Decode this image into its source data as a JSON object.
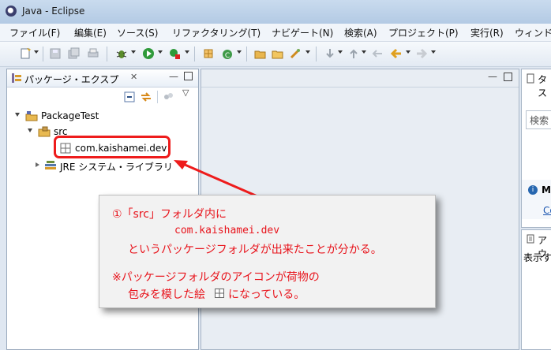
{
  "window": {
    "title": "Java - Eclipse"
  },
  "menu": [
    "ファイル(F)",
    "編集(E)",
    "ソース(S)",
    "リファクタリング(T)",
    "ナビゲート(N)",
    "検索(A)",
    "プロジェクト(P)",
    "実行(R)",
    "ウィンド"
  ],
  "explorer": {
    "tab_label": "パッケージ・エクスプ",
    "tree": {
      "project": "PackageTest",
      "src": "src",
      "package": "com.kaishamei.dev",
      "jre": "JRE システム・ライブラリ"
    }
  },
  "right": {
    "tab1": "タス",
    "search_placeholder": "検索",
    "info_label": "M",
    "link": "Co",
    "tab2": "アウ",
    "text": "表示す"
  },
  "callout": {
    "line1": "①「src」フォルダ内に",
    "line2": "com.kaishamei.dev",
    "line3": "というパッケージフォルダが出来たことが分かる。",
    "line4": "※パッケージフォルダのアイコンが荷物の",
    "line5a": "包みを模した絵",
    "line5b": "になっている。"
  },
  "colors": {
    "accent_red": "#ee1c1c",
    "callout_text": "#e8141c"
  }
}
